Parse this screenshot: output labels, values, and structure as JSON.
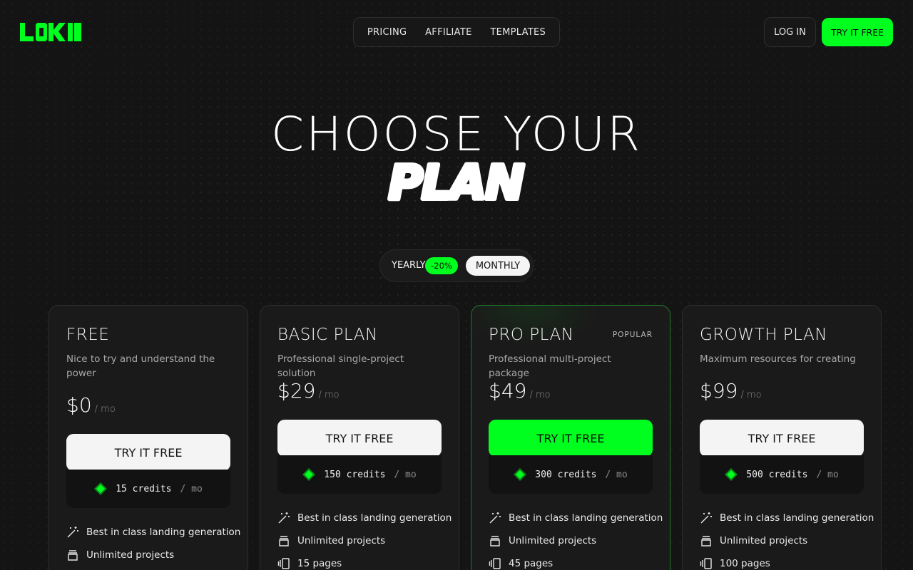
{
  "header": {
    "nav": [
      "PRICING",
      "AFFILIATE",
      "TEMPLATES"
    ],
    "login_label": "LOG IN",
    "cta_label": "TRY IT FREE"
  },
  "hero": {
    "title_line1": "CHOOSE YOUR",
    "title_line2": "PLAN"
  },
  "billing_toggle": {
    "yearly_label": "YEARLY",
    "discount": "-20%",
    "monthly_label": "MONTHLY",
    "selected": "MONTHLY"
  },
  "colors": {
    "accent": "#00ff1e",
    "background": "#141414",
    "card": "#1a1a1a"
  },
  "plans": [
    {
      "name": "FREE",
      "description": "Nice to try and understand the power",
      "price": "$0",
      "unit": "/ mo",
      "button": "TRY IT FREE",
      "credits": "15 credits",
      "credits_unit": "/ mo",
      "features": [
        "Best in class landing generation",
        "Unlimited projects"
      ]
    },
    {
      "name": "BASIC PLAN",
      "description": "Professional single-project solution",
      "price": "$29",
      "unit": "/ mo",
      "button": "TRY IT FREE",
      "credits": "150 credits",
      "credits_unit": "/ mo",
      "features": [
        "Best in class landing generation",
        "Unlimited projects",
        "15 pages"
      ]
    },
    {
      "name": "PRO PLAN",
      "badge": "POPULAR",
      "description": "Professional multi-project package",
      "price": "$49",
      "unit": "/ mo",
      "button": "TRY IT FREE",
      "credits": "300 credits",
      "credits_unit": "/ mo",
      "features": [
        "Best in class landing generation",
        "Unlimited projects",
        "45 pages"
      ]
    },
    {
      "name": "GROWTH PLAN",
      "description": "Maximum resources for creating",
      "price": "$99",
      "unit": "/ mo",
      "button": "TRY IT FREE",
      "credits": "500 credits",
      "credits_unit": "/ mo",
      "features": [
        "Best in class landing generation",
        "Unlimited projects",
        "100 pages"
      ]
    }
  ],
  "icons": {
    "logo": "loki-logo",
    "gem": "credits-gem-icon",
    "features": [
      "magic-wand-icon",
      "stack-icon",
      "pages-icon"
    ]
  }
}
